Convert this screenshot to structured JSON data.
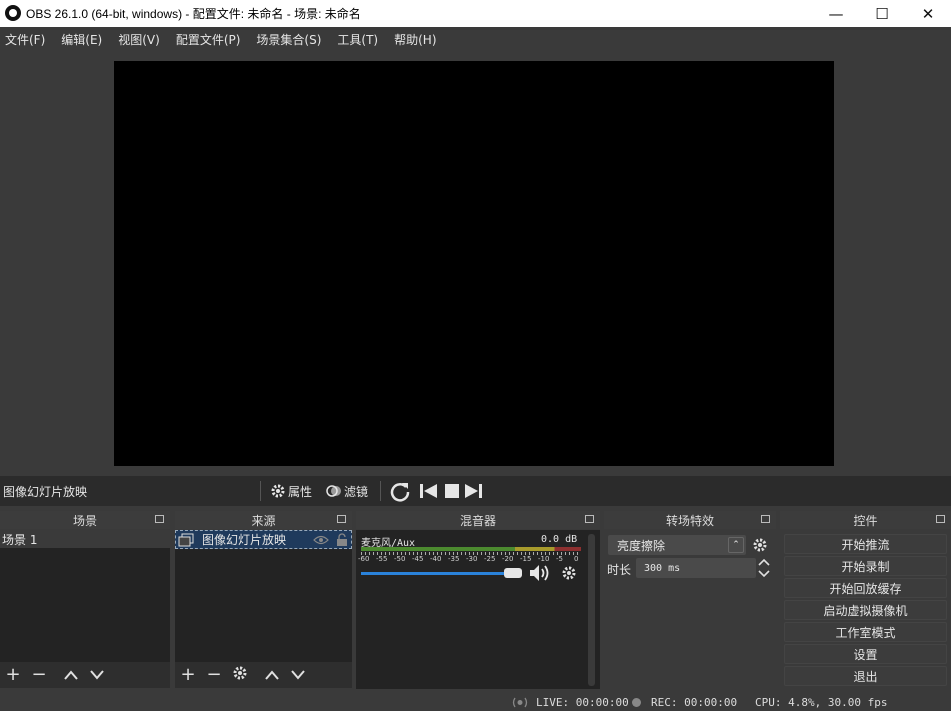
{
  "window": {
    "title": "OBS 26.1.0 (64-bit, windows) - 配置文件: 未命名 - 场景: 未命名",
    "minimize": "—",
    "maximize": "☐",
    "close": "✕"
  },
  "menu": [
    "文件(F)",
    "编辑(E)",
    "视图(V)",
    "配置文件(P)",
    "场景集合(S)",
    "工具(T)",
    "帮助(H)"
  ],
  "source_toolbar": {
    "selected_source": "图像幻灯片放映",
    "properties": "属性",
    "filters": "滤镜"
  },
  "scenes": {
    "title": "场景",
    "items": [
      "场景 1"
    ]
  },
  "sources": {
    "title": "来源",
    "items": [
      {
        "name": "图像幻灯片放映",
        "visible": true,
        "locked": false
      }
    ]
  },
  "mixer": {
    "title": "混音器",
    "channels": [
      {
        "name": "麦克风/Aux",
        "level": "0.0 dB",
        "volume": 0.9
      }
    ],
    "scale": [
      "-60",
      "-55",
      "-50",
      "-45",
      "-40",
      "-35",
      "-30",
      "-25",
      "-20",
      "-15",
      "-10",
      "-5",
      "0"
    ]
  },
  "transitions": {
    "title": "转场特效",
    "selected": "亮度擦除",
    "duration_label": "时长",
    "duration_value": "300 ms"
  },
  "controls": {
    "title": "控件",
    "buttons": [
      "开始推流",
      "开始录制",
      "开始回放缓存",
      "启动虚拟摄像机",
      "工作室模式",
      "设置",
      "退出"
    ]
  },
  "status": {
    "live": "LIVE: 00:00:00",
    "rec": "REC: 00:00:00",
    "cpu": "CPU: 4.8%, 30.00 fps"
  },
  "colors": {
    "accent": "#2a82da",
    "panel": "#232323",
    "background": "#3a3a3a"
  }
}
